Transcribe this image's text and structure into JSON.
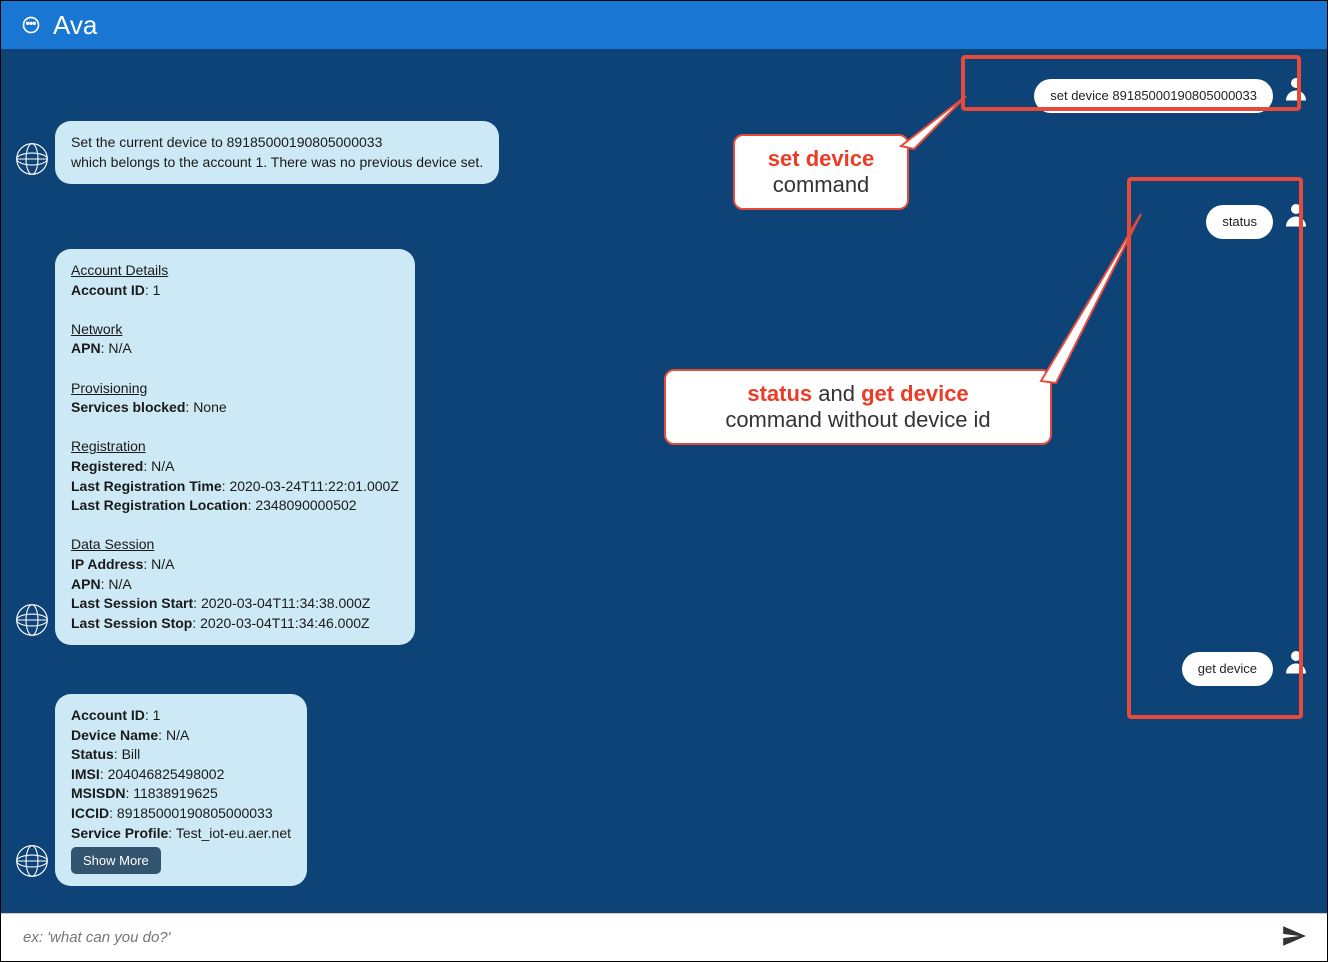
{
  "header": {
    "title": "Ava"
  },
  "messages": {
    "user_set_device": "set device 89185000190805000033",
    "bot_set_confirm_line1": "Set the current device to 89185000190805000033",
    "bot_set_confirm_line2": "which belongs to the account 1. There was no previous device set.",
    "user_status": "status",
    "user_get_device": "get device"
  },
  "status_card": {
    "account_section": "Account Details",
    "account_id_label": "Account ID",
    "account_id_value": "1",
    "network_section": "Network",
    "apn_label": "APN",
    "apn_value": "N/A",
    "provisioning_section": "Provisioning",
    "services_blocked_label": "Services blocked",
    "services_blocked_value": "None",
    "registration_section": "Registration",
    "registered_label": "Registered",
    "registered_value": "N/A",
    "last_reg_time_label": "Last Registration Time",
    "last_reg_time_value": "2020-03-24T11:22:01.000Z",
    "last_reg_loc_label": "Last Registration Location",
    "last_reg_loc_value": "2348090000502",
    "data_session_section": "Data Session",
    "ip_label": "IP Address",
    "ip_value": "N/A",
    "ds_apn_label": "APN",
    "ds_apn_value": "N/A",
    "last_start_label": "Last Session Start",
    "last_start_value": "2020-03-04T11:34:38.000Z",
    "last_stop_label": "Last Session Stop",
    "last_stop_value": "2020-03-04T11:34:46.000Z"
  },
  "device_card": {
    "account_id_label": "Account ID",
    "account_id_value": "1",
    "device_name_label": "Device Name",
    "device_name_value": "N/A",
    "status_label": "Status",
    "status_value": "Bill",
    "imsi_label": "IMSI",
    "imsi_value": "204046825498002",
    "msisdn_label": "MSISDN",
    "msisdn_value": "11838919625",
    "iccid_label": "ICCID",
    "iccid_value": "89185000190805000033",
    "svc_profile_label": "Service Profile",
    "svc_profile_value": "Test_iot-eu.aer.net",
    "show_more": "Show More"
  },
  "input": {
    "placeholder": "ex: 'what can you do?'"
  },
  "callouts": {
    "c1_bold": "set device",
    "c1_rest": "command",
    "c2_bold1": "status",
    "c2_mid": " and ",
    "c2_bold2": "get device",
    "c2_rest": "command without device id"
  }
}
